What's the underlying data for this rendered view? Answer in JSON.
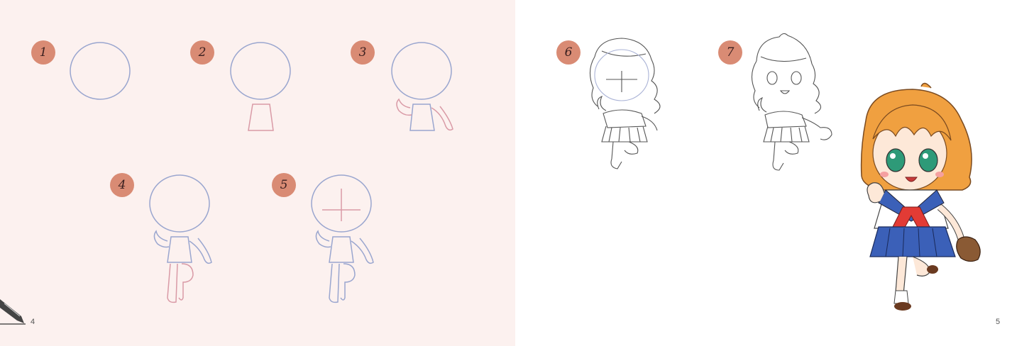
{
  "steps": [
    {
      "number": "1"
    },
    {
      "number": "2"
    },
    {
      "number": "3"
    },
    {
      "number": "4"
    },
    {
      "number": "5"
    },
    {
      "number": "6"
    },
    {
      "number": "7"
    }
  ],
  "pages": {
    "left_number": "4",
    "right_number": "5"
  },
  "colors": {
    "left_page_bg": "#fcf1ef",
    "badge": "#d98b74",
    "guide_blue": "#9aa6cf",
    "guide_pink": "#d99aa6",
    "hair": "#f0a040",
    "skirt": "#3b60b8",
    "scarf": "#e23b35"
  }
}
